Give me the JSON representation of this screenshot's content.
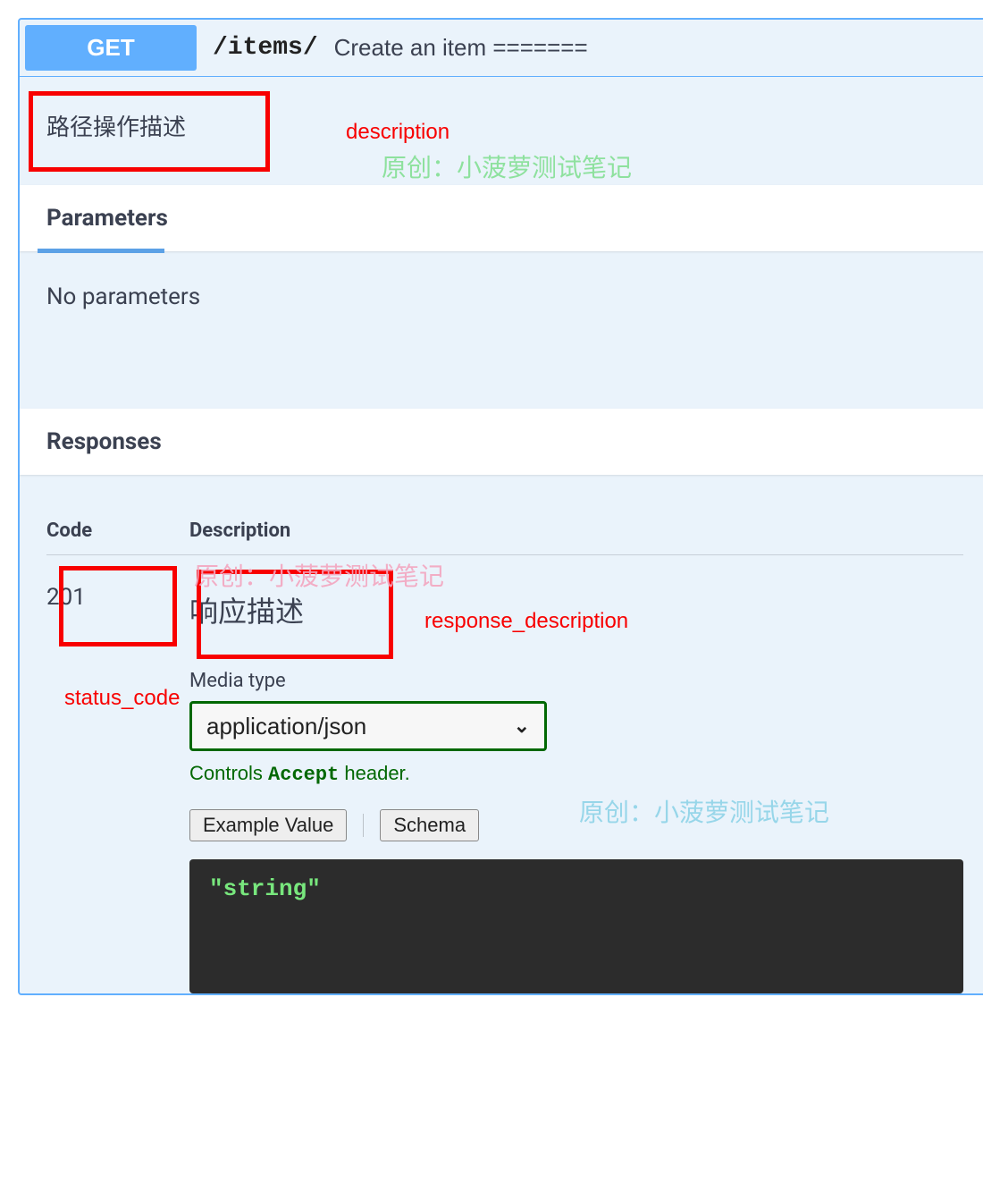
{
  "operation": {
    "method": "GET",
    "path": "/items/",
    "summary": "Create an item =======",
    "description": "路径操作描述"
  },
  "sections": {
    "parameters_title": "Parameters",
    "no_parameters": "No parameters",
    "responses_title": "Responses"
  },
  "responses": {
    "code_header": "Code",
    "desc_header": "Description",
    "code": "201",
    "description": "响应描述",
    "media_label": "Media type",
    "media_value": "application/json",
    "controls_pre": "Controls ",
    "controls_accept": "Accept",
    "controls_post": " header.",
    "tab_example": "Example Value",
    "tab_schema": "Schema",
    "example_body": "\"string\""
  },
  "annotations": {
    "description": "description",
    "status_code": "status_code",
    "response_description": "response_description"
  },
  "watermark": "原创：小菠萝测试笔记"
}
